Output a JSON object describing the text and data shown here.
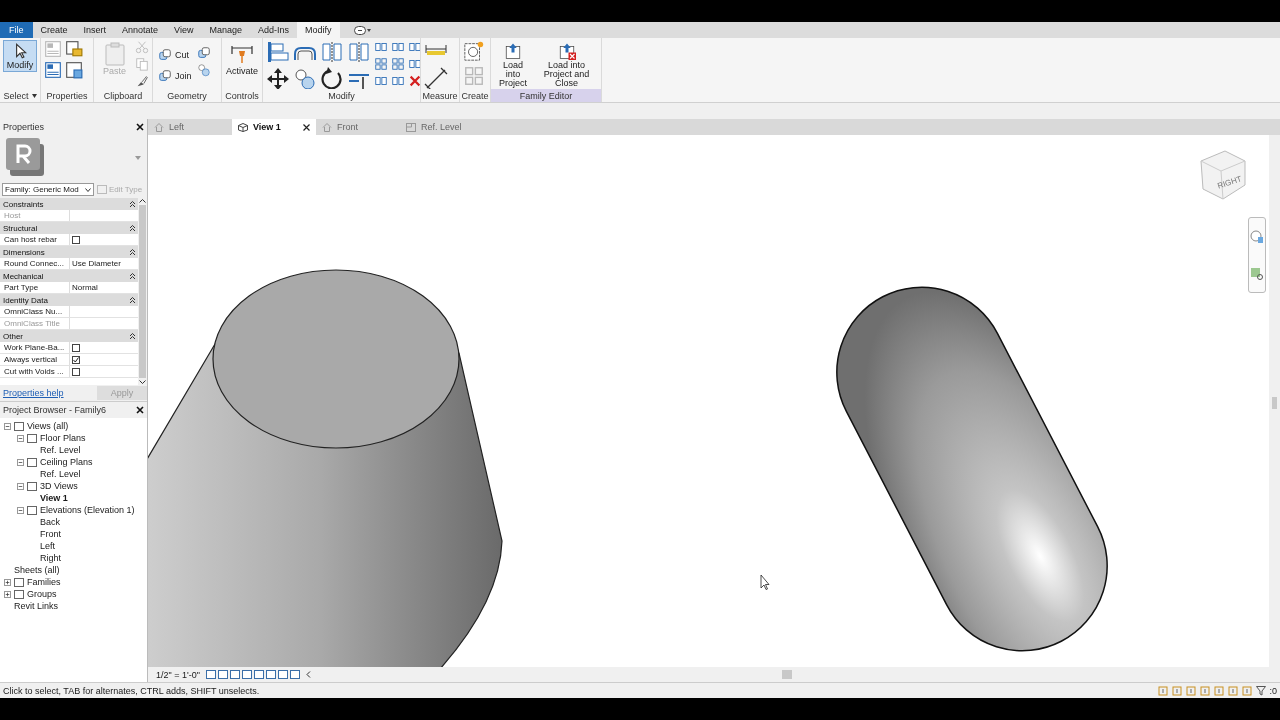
{
  "menu_tabs": [
    {
      "label": "File",
      "kind": "file",
      "selected": false
    },
    {
      "label": "Create",
      "kind": "tab",
      "selected": false
    },
    {
      "label": "Insert",
      "kind": "tab",
      "selected": false
    },
    {
      "label": "Annotate",
      "kind": "tab",
      "selected": false
    },
    {
      "label": "View",
      "kind": "tab",
      "selected": false
    },
    {
      "label": "Manage",
      "kind": "tab",
      "selected": false
    },
    {
      "label": "Add-Ins",
      "kind": "tab",
      "selected": false
    },
    {
      "label": "Modify",
      "kind": "tab",
      "selected": true
    }
  ],
  "ribbon": {
    "panels": [
      {
        "label": "Select",
        "menu": true,
        "highlighted": false,
        "tools": [
          {
            "label": "Modify",
            "kind": "large",
            "selected": true,
            "disabled": false
          }
        ]
      },
      {
        "label": "Properties",
        "menu": false,
        "highlighted": false
      },
      {
        "label": "Clipboard",
        "menu": false,
        "highlighted": false,
        "tools": [
          {
            "label": "Paste",
            "kind": "large",
            "selected": false,
            "disabled": true
          }
        ]
      },
      {
        "label": "Geometry",
        "menu": false,
        "highlighted": false,
        "tools": [
          {
            "label": "Cut",
            "kind": "small",
            "selected": false,
            "disabled": false
          },
          {
            "label": "Join",
            "kind": "small",
            "selected": false,
            "disabled": false
          }
        ]
      },
      {
        "label": "Controls",
        "menu": false,
        "highlighted": false,
        "tools": [
          {
            "label": "Activate",
            "kind": "large",
            "selected": false,
            "disabled": false
          }
        ]
      },
      {
        "label": "Modify",
        "menu": false,
        "highlighted": false
      },
      {
        "label": "Measure",
        "menu": false,
        "highlighted": false
      },
      {
        "label": "Create",
        "menu": false,
        "highlighted": false
      },
      {
        "label": "Family Editor",
        "menu": false,
        "highlighted": true,
        "tools": [
          {
            "label": "Load into Project",
            "kind": "large",
            "selected": false,
            "disabled": false
          },
          {
            "label": "Load into Project and Close",
            "kind": "large",
            "selected": false,
            "disabled": false
          }
        ]
      }
    ]
  },
  "properties": {
    "title": "Properties",
    "type_selector": "Family: Generic Mod",
    "edit_type": "Edit Type",
    "groups": [
      {
        "name": "Constraints",
        "rows": [
          {
            "label": "Host",
            "kind": "text",
            "value": "",
            "disabled": true
          }
        ]
      },
      {
        "name": "Structural",
        "rows": [
          {
            "label": "Can host rebar",
            "kind": "checkbox",
            "checked": false,
            "disabled": false
          }
        ]
      },
      {
        "name": "Dimensions",
        "rows": [
          {
            "label": "Round Connec...",
            "kind": "text",
            "value": "Use Diameter",
            "disabled": false
          }
        ]
      },
      {
        "name": "Mechanical",
        "rows": [
          {
            "label": "Part Type",
            "kind": "text",
            "value": "Normal",
            "disabled": false
          }
        ]
      },
      {
        "name": "Identity Data",
        "rows": [
          {
            "label": "OmniClass Nu...",
            "kind": "text",
            "value": "",
            "disabled": false
          },
          {
            "label": "OmniClass Title",
            "kind": "text",
            "value": "",
            "disabled": true
          }
        ]
      },
      {
        "name": "Other",
        "rows": [
          {
            "label": "Work Plane-Ba...",
            "kind": "checkbox",
            "checked": false,
            "disabled": false
          },
          {
            "label": "Always vertical",
            "kind": "checkbox",
            "checked": true,
            "disabled": false
          },
          {
            "label": "Cut with Voids ...",
            "kind": "checkbox",
            "checked": false,
            "disabled": false
          }
        ]
      }
    ],
    "help_link": "Properties help",
    "apply": "Apply"
  },
  "project_browser": {
    "title": "Project Browser - Family6",
    "tree": [
      {
        "label": "Views (all)",
        "expanded": true,
        "active": false,
        "children": [
          {
            "label": "Floor Plans",
            "expanded": true,
            "active": false,
            "children": [
              {
                "label": "Ref. Level",
                "active": false
              }
            ]
          },
          {
            "label": "Ceiling Plans",
            "expanded": true,
            "active": false,
            "children": [
              {
                "label": "Ref. Level",
                "active": false
              }
            ]
          },
          {
            "label": "3D Views",
            "expanded": true,
            "active": false,
            "children": [
              {
                "label": "View 1",
                "active": true
              }
            ]
          },
          {
            "label": "Elevations (Elevation 1)",
            "expanded": true,
            "active": false,
            "children": [
              {
                "label": "Back",
                "active": false
              },
              {
                "label": "Front",
                "active": false
              },
              {
                "label": "Left",
                "active": false
              },
              {
                "label": "Right",
                "active": false
              }
            ]
          }
        ]
      },
      {
        "label": "Sheets (all)",
        "active": false
      },
      {
        "label": "Families",
        "expanded": false,
        "active": false
      },
      {
        "label": "Groups",
        "expanded": false,
        "active": false
      },
      {
        "label": "Revit Links",
        "active": false
      }
    ]
  },
  "view_tabs": [
    {
      "label": "Left",
      "kind": "elevation",
      "selected": false
    },
    {
      "label": "View 1",
      "kind": "model",
      "selected": true
    },
    {
      "label": "Front",
      "kind": "elevation",
      "selected": false
    },
    {
      "label": "Ref. Level",
      "kind": "plan",
      "selected": false
    }
  ],
  "view_cube": {
    "face": "RIGHT"
  },
  "view_control": {
    "scale": "1/2\" = 1'-0\""
  },
  "status_bar": {
    "message": "Click to select, TAB for alternates, CTRL adds, SHIFT unselects.",
    "filter_count": ":0"
  }
}
